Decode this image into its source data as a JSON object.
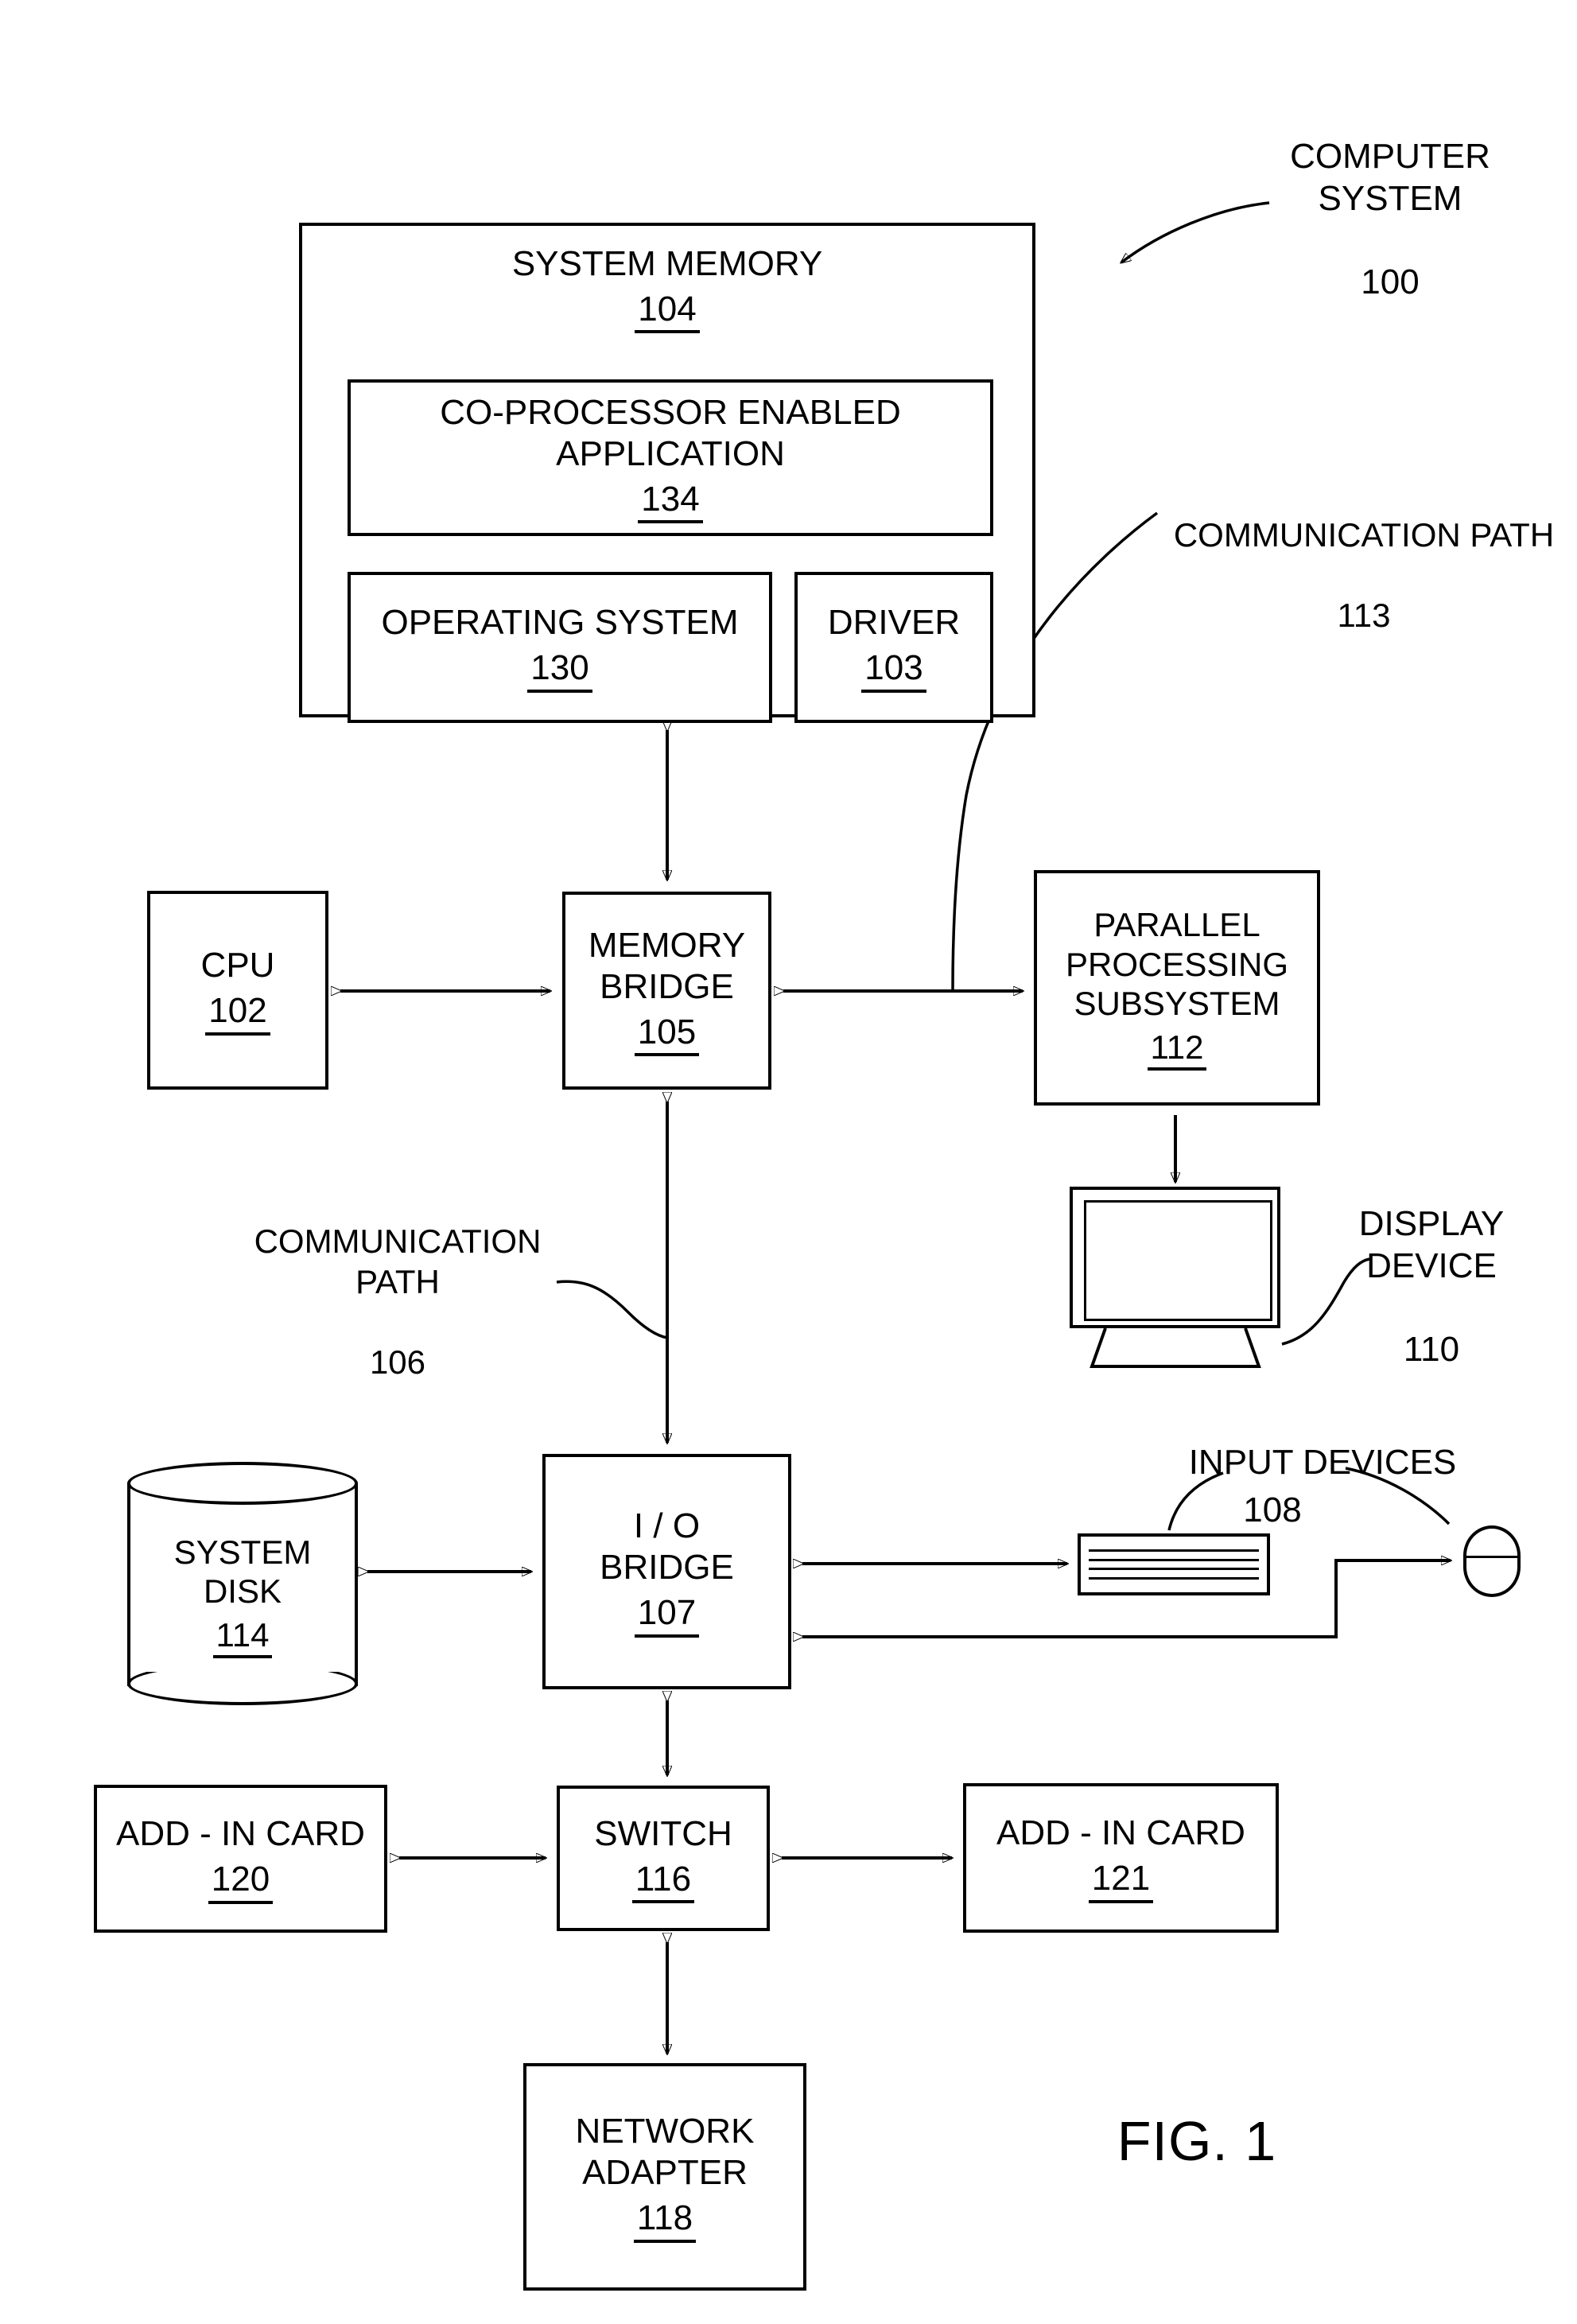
{
  "figure": {
    "label": "FIG. 1",
    "title_callout": "COMPUTER\nSYSTEM",
    "title_callout_number": "100"
  },
  "blocks": {
    "system_memory": {
      "label": "SYSTEM MEMORY",
      "number": "104"
    },
    "coprocessor_app": {
      "label": "CO-PROCESSOR ENABLED\nAPPLICATION",
      "number": "134"
    },
    "operating_system": {
      "label": "OPERATING SYSTEM",
      "number": "130"
    },
    "driver": {
      "label": "DRIVER",
      "number": "103"
    },
    "cpu": {
      "label": "CPU",
      "number": "102"
    },
    "memory_bridge": {
      "label": "MEMORY\nBRIDGE",
      "number": "105"
    },
    "parallel_processing_subsystem": {
      "label": "PARALLEL\nPROCESSING\nSUBSYSTEM",
      "number": "112"
    },
    "io_bridge": {
      "label": "I / O\nBRIDGE",
      "number": "107"
    },
    "system_disk": {
      "label": "SYSTEM\nDISK",
      "number": "114"
    },
    "switch": {
      "label": "SWITCH",
      "number": "116"
    },
    "add_in_card_left": {
      "label": "ADD - IN CARD",
      "number": "120"
    },
    "add_in_card_right": {
      "label": "ADD - IN CARD",
      "number": "121"
    },
    "network_adapter": {
      "label": "NETWORK\nADAPTER",
      "number": "118"
    }
  },
  "callouts": {
    "communication_path_113": {
      "label": "COMMUNICATION PATH",
      "number": "113"
    },
    "communication_path_106": {
      "label": "COMMUNICATION\nPATH",
      "number": "106"
    },
    "display_device": {
      "label": "DISPLAY\nDEVICE",
      "number": "110"
    },
    "input_devices": {
      "label": "INPUT  DEVICES",
      "number": "108"
    }
  },
  "colors": {
    "stroke": "#000000",
    "background": "#ffffff"
  }
}
